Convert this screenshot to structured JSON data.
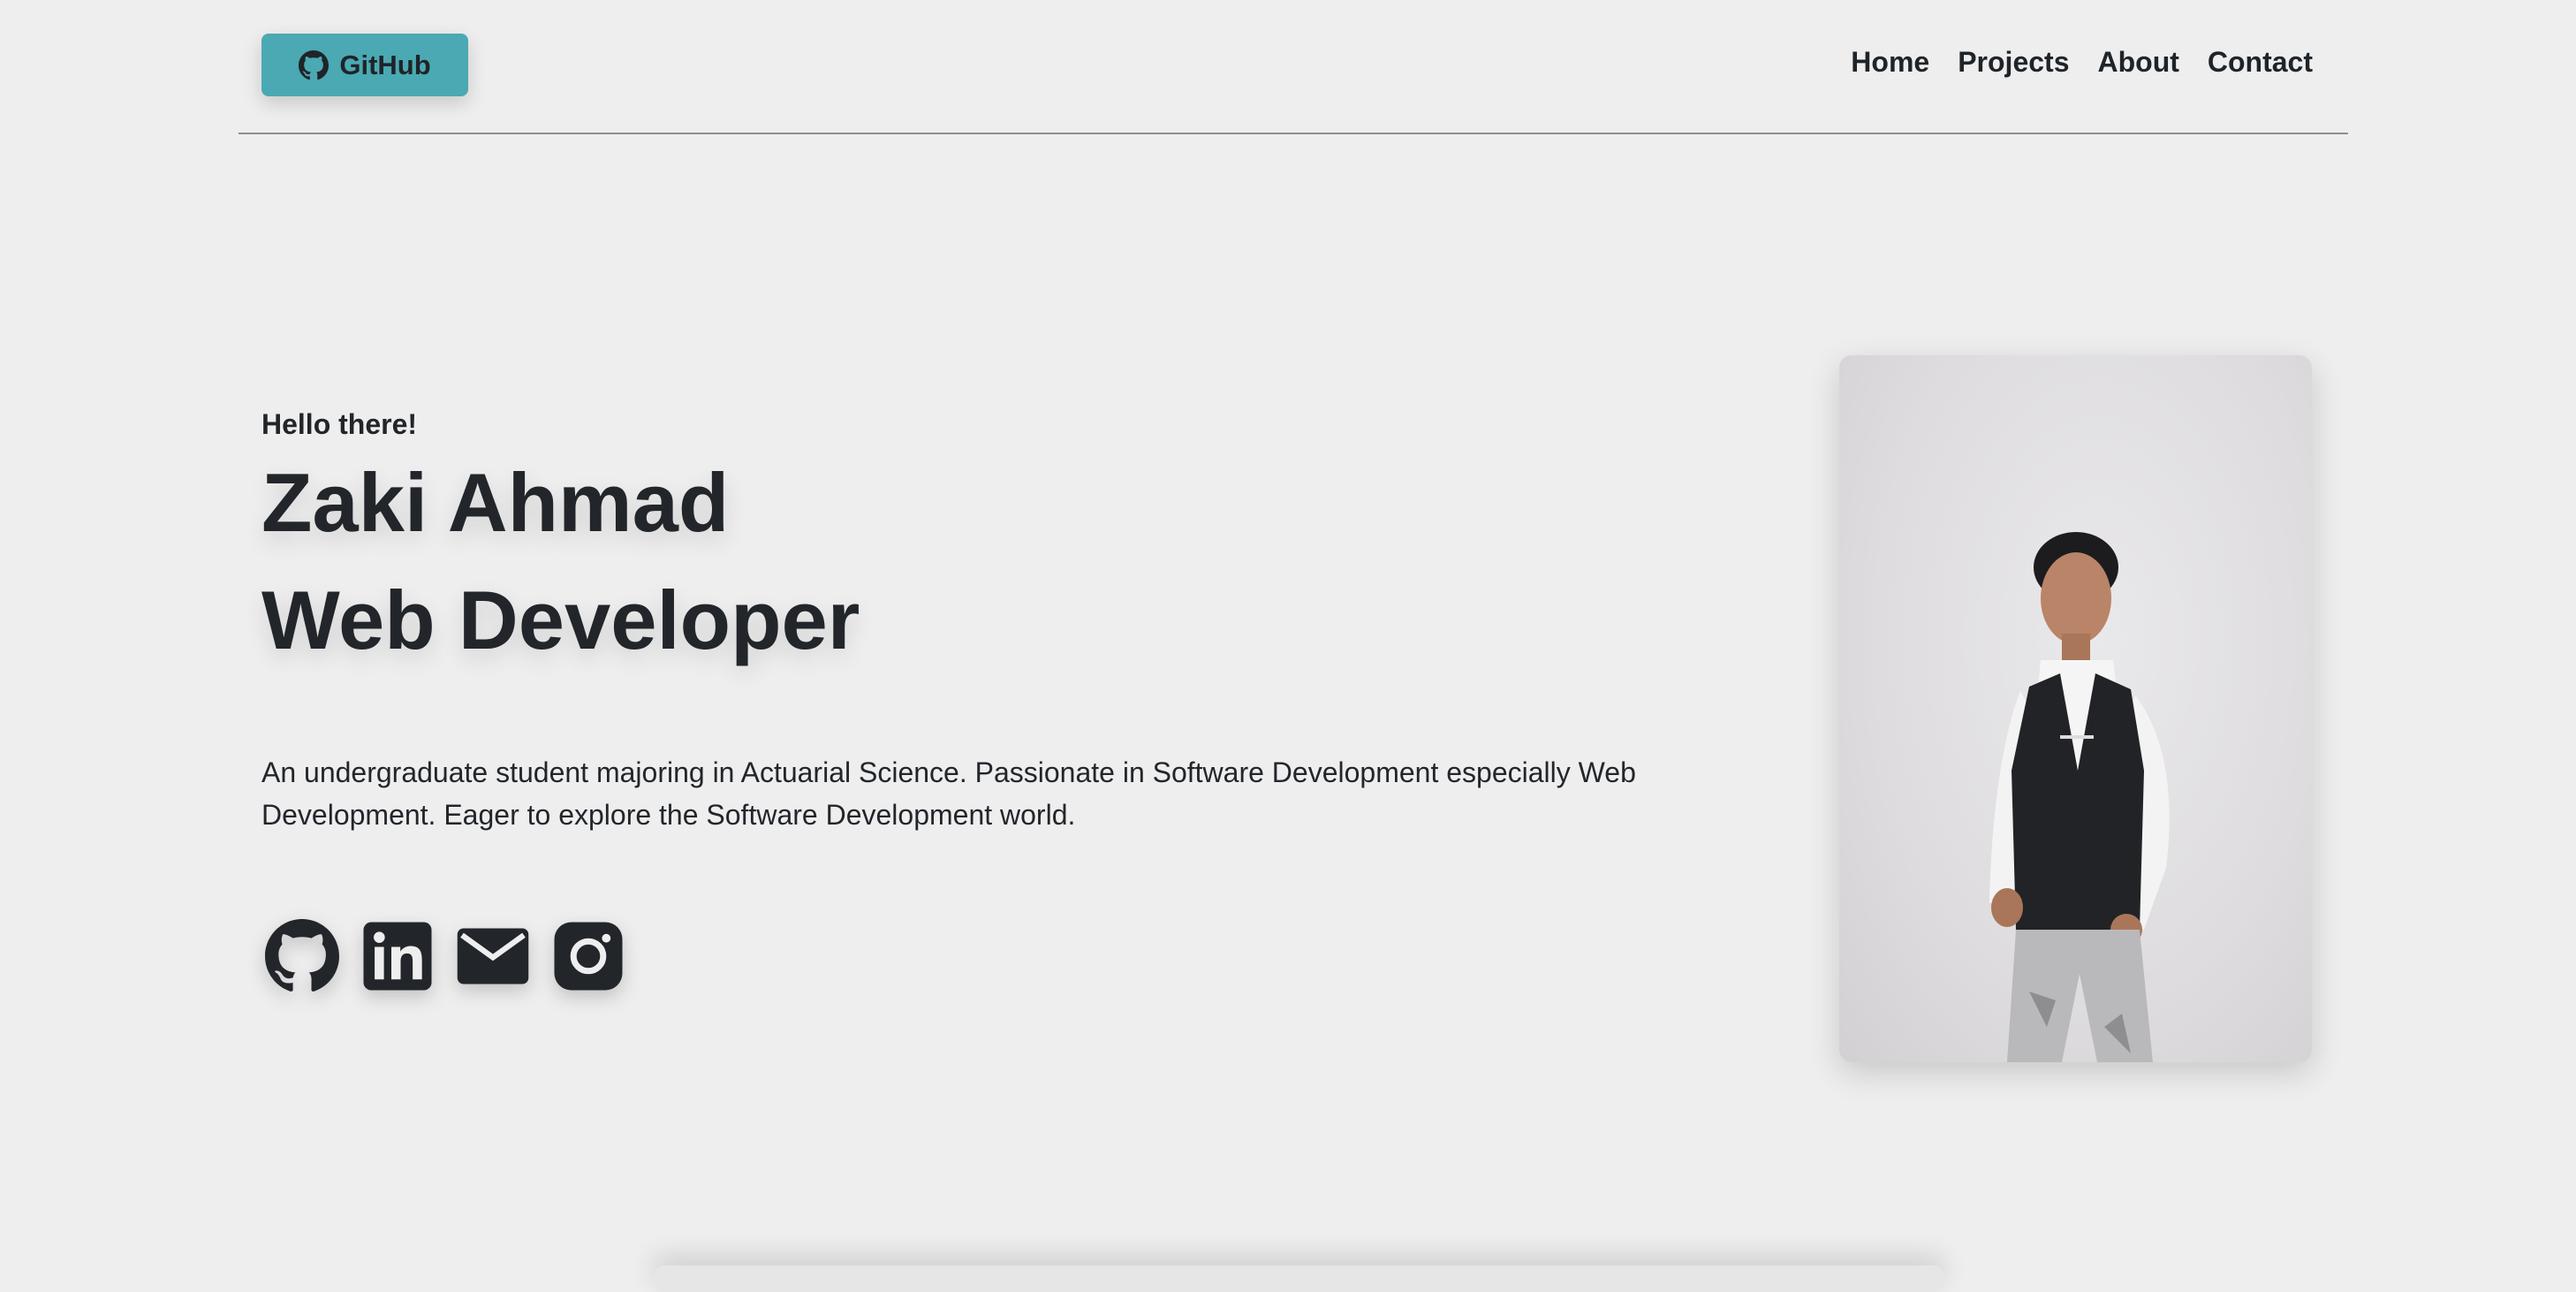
{
  "header": {
    "github_button_label": "GitHub",
    "nav": [
      {
        "label": "Home"
      },
      {
        "label": "Projects"
      },
      {
        "label": "About"
      },
      {
        "label": "Contact"
      }
    ]
  },
  "hero": {
    "greeting": "Hello there!",
    "name": "Zaki Ahmad",
    "role": "Web Developer",
    "description": "An undergraduate student majoring in Actuarial Science. Passionate in Software Development especially Web Development. Eager to explore the Software Development world.",
    "socials": [
      {
        "icon": "github-icon"
      },
      {
        "icon": "linkedin-icon"
      },
      {
        "icon": "mail-icon"
      },
      {
        "icon": "instagram-icon"
      }
    ]
  },
  "colors": {
    "background": "#eeeeee",
    "accent": "#4aa9b2",
    "text": "#22262b"
  }
}
